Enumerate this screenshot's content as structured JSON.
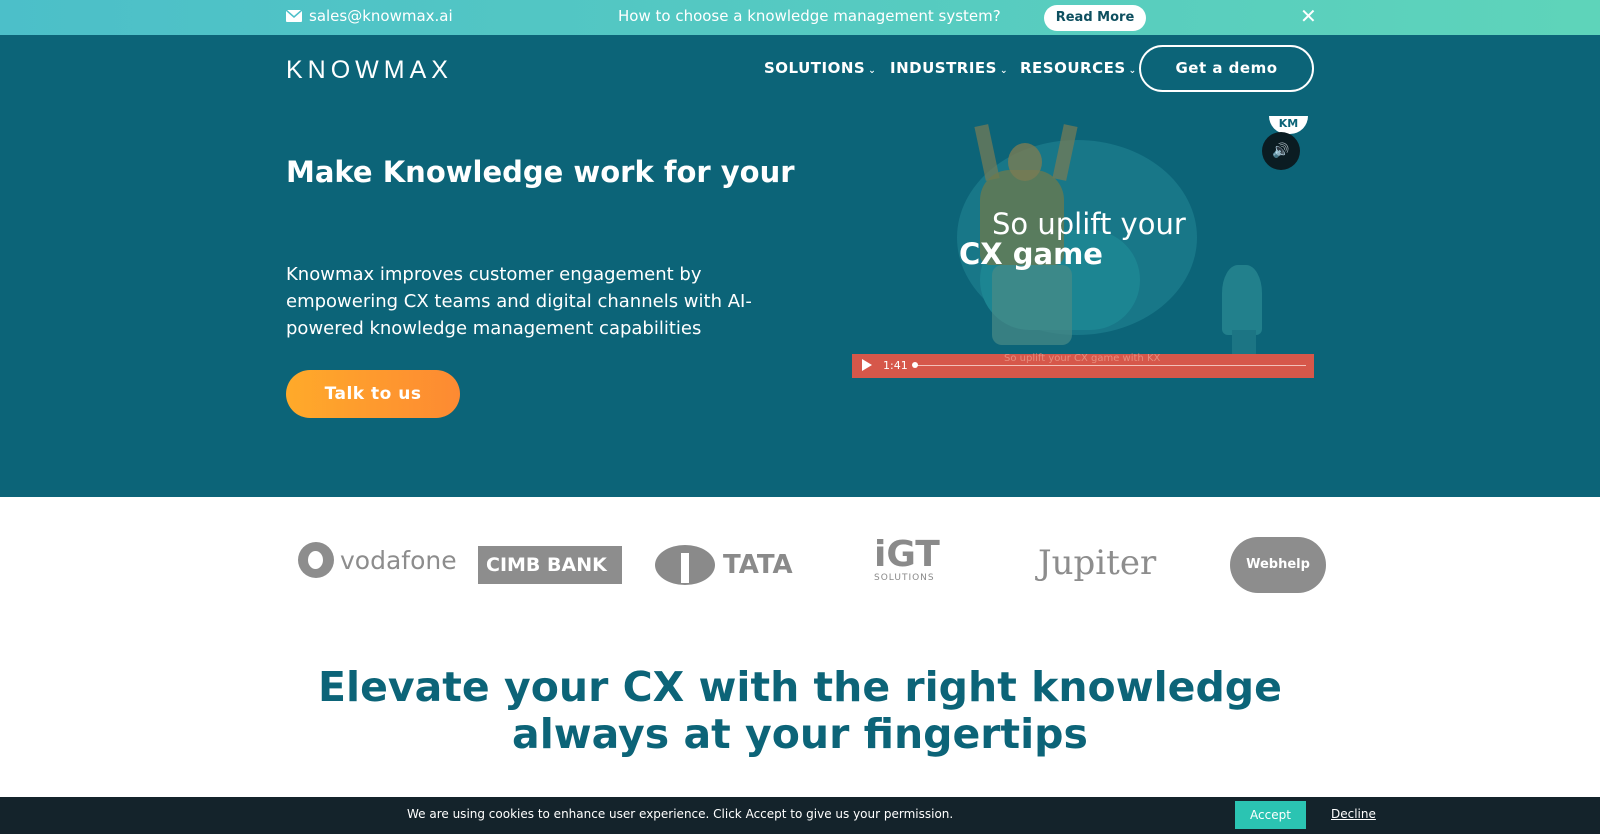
{
  "topbar": {
    "email": "sales@knowmax.ai",
    "promo_text": "How to choose a knowledge management system?",
    "read_more_label": "Read More",
    "close_symbol": "✕"
  },
  "header": {
    "logo_text": "KNOWMAX",
    "nav": [
      {
        "label": "SOLUTIONS"
      },
      {
        "label": "INDUSTRIES"
      },
      {
        "label": "RESOURCES"
      }
    ],
    "demo_label": "Get a demo"
  },
  "hero": {
    "headline": "Make Knowledge work for your",
    "description": "Knowmax improves customer engagement by empowering CX teams and digital channels with AI-powered knowledge management capabilities",
    "cta_label": "Talk to us"
  },
  "video": {
    "badge": "KM",
    "line1": "So uplift your",
    "line2": "CX game",
    "time": "1:41",
    "caption": "So uplift your CX game with KX",
    "progress_fraction": 0.0
  },
  "logos": [
    {
      "name": "vodafone",
      "text": "vodafone"
    },
    {
      "name": "cimb",
      "text": "CIMB BANK"
    },
    {
      "name": "tata",
      "text": "TATA"
    },
    {
      "name": "igt",
      "text": "iGT",
      "sub": "SOLUTIONS"
    },
    {
      "name": "jupiter",
      "text": "Jupiter"
    },
    {
      "name": "webhelp",
      "text": "Webhelp"
    }
  ],
  "section": {
    "title_line1": "Elevate your CX with the right knowledge",
    "title_line2": "always at your fingertips"
  },
  "cookie": {
    "message": "We are using cookies to enhance user experience. Click Accept to give us your permission.",
    "accept_label": "Accept",
    "decline_label": "Decline"
  },
  "colors": {
    "hero_bg": "#0c6478",
    "topbar_start": "#4cbfc9",
    "topbar_end": "#5ed4ba",
    "cta_orange": "#fd8a32",
    "accept_teal": "#2bc4b2",
    "video_bar": "#d6574a"
  }
}
